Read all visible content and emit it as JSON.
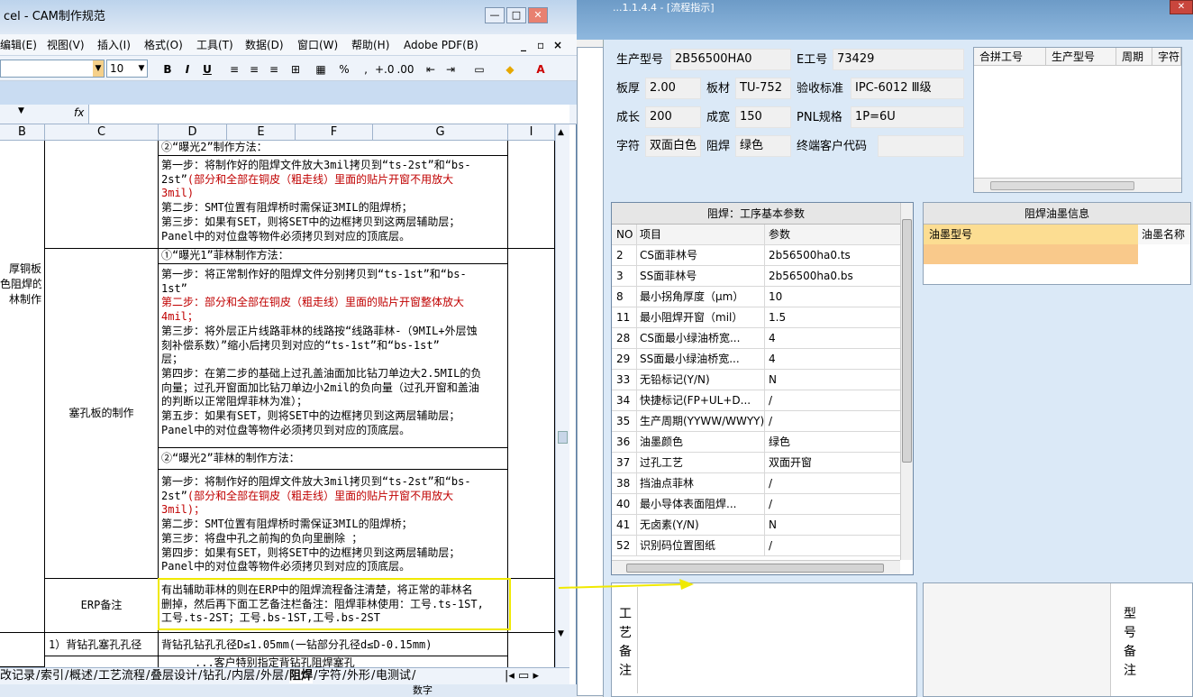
{
  "right_window": {
    "title": "...1.1.4.4 - [流程指示]",
    "close_glyph": "✕",
    "info": {
      "prod_model_label": "生产型号",
      "prod_model": "2B56500HA0",
      "e_no_label": "E工号",
      "e_no": "73429",
      "thickness_label": "板厚",
      "thickness": "2.00",
      "material_label": "板材",
      "material": "TU-752",
      "standard_label": "验收标准",
      "standard": "IPC-6012 Ⅲ级",
      "grow_len_label": "成长",
      "grow_len": "200",
      "grow_wid_label": "成宽",
      "grow_wid": "150",
      "pnl_label": "PNL规格",
      "pnl": "1P=6U",
      "char_label": "字符",
      "char_value": "双面白色",
      "mask_label": "阻焊",
      "mask_value": "绿色",
      "customer_label": "终端客户代码",
      "customer": ""
    },
    "merge_grid": {
      "headers": [
        "合拼工号",
        "生产型号",
        "周期",
        "字符"
      ]
    },
    "solder_params": {
      "title": "阻焊：工序基本参数",
      "headers": [
        "NO",
        "项目",
        "参数"
      ],
      "rows": [
        {
          "no": "2",
          "item": "CS面菲林号",
          "value": "2b56500ha0.ts"
        },
        {
          "no": "3",
          "item": "SS面菲林号",
          "value": "2b56500ha0.bs"
        },
        {
          "no": "8",
          "item": "最小拐角厚度（μm）",
          "value": "10"
        },
        {
          "no": "11",
          "item": "最小阻焊开窗（mil）",
          "value": "1.5"
        },
        {
          "no": "28",
          "item": "CS面最小绿油桥宽...",
          "value": "4"
        },
        {
          "no": "29",
          "item": "SS面最小绿油桥宽...",
          "value": "4"
        },
        {
          "no": "33",
          "item": "无铅标记(Y/N)",
          "value": "N"
        },
        {
          "no": "34",
          "item": "快捷标记(FP+UL+D...",
          "value": "/"
        },
        {
          "no": "35",
          "item": "生产周期(YYWW/WWYY)",
          "value": "/"
        },
        {
          "no": "36",
          "item": "油墨颜色",
          "value": "绿色"
        },
        {
          "no": "37",
          "item": "过孔工艺",
          "value": "双面开窗"
        },
        {
          "no": "38",
          "item": "挡油点菲林",
          "value": "/"
        },
        {
          "no": "40",
          "item": "最小导体表面阻焊...",
          "value": "/"
        },
        {
          "no": "41",
          "item": "无卤素(Y/N)",
          "value": "N"
        },
        {
          "no": "52",
          "item": "识别码位置图纸",
          "value": "/"
        }
      ]
    },
    "ink_info": {
      "title": "阻焊油墨信息",
      "headers": [
        "油墨型号",
        "油墨名称"
      ]
    },
    "notes": {
      "process_label": [
        "工",
        "艺",
        "备",
        "注"
      ],
      "model_label": [
        "型",
        "号",
        "备",
        "注"
      ]
    }
  },
  "excel": {
    "title": "cel - CAM制作规范",
    "window_buttons": [
      "—",
      "□",
      "✕"
    ],
    "menu": [
      "编辑(E)",
      "视图(V)",
      "插入(I)",
      "格式(O)",
      "工具(T)",
      "数据(D)",
      "窗口(W)",
      "帮助(H)",
      "Adobe PDF(B)"
    ],
    "menu_right": [
      "_",
      "▫",
      "×"
    ],
    "font_size": "10",
    "toolbar": [
      "B",
      "I",
      "U",
      "≡",
      "≡",
      "≡",
      "⊞",
      "▦",
      "%",
      ",",
      "+.0",
      ".00",
      "⇤",
      "⇥",
      "▭",
      "◆",
      "A"
    ],
    "fx": "fx",
    "columns": [
      "B",
      "C",
      "D",
      "E",
      "F",
      "G",
      "I"
    ],
    "cells": {
      "b_label": [
        "厚铜板",
        "色阻焊的",
        "林制作"
      ],
      "c_plug": "塞孔板的制作",
      "c_erp": "ERP备注",
      "c_back": "1）背钻孔塞孔孔径",
      "d1": [
        "②“曝光2”制作方法："
      ],
      "d2": [
        {
          "t": "第一步：将制作好的阻焊文件放大3mil拷贝到“ts-2st”和“bs-",
          "r": false
        },
        {
          "t": "2st”",
          "r": false,
          "tail": "(部分和全部在铜皮（粗走线）里面的贴片开窗不用放大"
        },
        {
          "t": "3mil)",
          "r": true
        },
        {
          "t": "第二步：SMT位置有阻焊桥时需保证3MIL的阻焊桥；",
          "r": false
        },
        {
          "t": "第三步：如果有SET，则将SET中的边框拷贝到这两层辅助层；",
          "r": false
        },
        {
          "t": "Panel中的对位盘等物件必须拷贝到对应的顶底层。",
          "r": false
        }
      ],
      "d3": [
        "①“曝光1”菲林制作方法："
      ],
      "d4": [
        {
          "t": "第一步：将正常制作好的阻焊文件分别拷贝到“ts-1st”和“bs-",
          "r": false
        },
        {
          "t": "1st”",
          "r": false
        },
        {
          "t": "第二步：部分和全部在铜皮（粗走线）里面的贴片开窗整体放大",
          "r": true
        },
        {
          "t": "4mil；",
          "r": true
        },
        {
          "t": "第三步：将外层正片线路菲林的线路按“线路菲林-（9MIL+外层蚀",
          "r": false
        },
        {
          "t": "刻补偿系数）”缩小后拷贝到对应的“ts-1st”和“bs-1st”",
          "r": false
        },
        {
          "t": "层；",
          "r": false
        },
        {
          "t": "第四步：在第二步的基础上过孔盖油面加比钻刀单边大2.5MIL的负",
          "r": false
        },
        {
          "t": "向量；过孔开窗面加比钻刀单边小2mil的负向量（过孔开窗和盖油",
          "r": false
        },
        {
          "t": "的判断以正常阻焊菲林为准）；",
          "r": false
        },
        {
          "t": "第五步：如果有SET，则将SET中的边框拷贝到这两层辅助层；",
          "r": false
        },
        {
          "t": "Panel中的对位盘等物件必须拷贝到对应的顶底层。",
          "r": false
        }
      ],
      "d5": [
        "②“曝光2”菲林的制作方法："
      ],
      "d6": [
        {
          "t": "第一步：将制作好的阻焊文件放大3mil拷贝到“ts-2st”和“bs-",
          "r": false
        },
        {
          "t": "2st”",
          "r": false,
          "tail": "(部分和全部在铜皮（粗走线）里面的贴片开窗不用放大"
        },
        {
          "t": "3mil)；",
          "r": true
        },
        {
          "t": "第二步：SMT位置有阻焊桥时需保证3MIL的阻焊桥；",
          "r": false
        },
        {
          "t": "第三步：将盘中孔之前掏的负向里删除 ；",
          "r": false
        },
        {
          "t": "第四步：如果有SET，则将SET中的边框拷贝到这两层辅助层；",
          "r": false
        },
        {
          "t": "Panel中的对位盘等物件必须拷贝到对应的顶底层。",
          "r": false
        }
      ],
      "d_erp": [
        "有出辅助菲林的则在ERP中的阻焊流程备注清楚，将正常的菲林名",
        "删掉，然后再下面工艺备注栏备注：阻焊菲林使用：工号.ts-1ST,",
        "工号.ts-2ST；工号.bs-1ST,工号.bs-2ST"
      ],
      "d_back": "背钻孔钻孔孔径D≤1.05mm(一钻部分孔径d≤D-0.15mm)",
      "d_last": "...客户特别指定背钻孔阻焊塞孔"
    },
    "tabs": [
      "改记录",
      "索引",
      "概述",
      "工艺流程",
      "叠层设计",
      "钻孔",
      "内层",
      "外层",
      "阻焊",
      "字符",
      "外形",
      "电测试"
    ],
    "status": "数字"
  },
  "colors": {
    "highlight": "#f0e900",
    "red_text": "#c00000",
    "ink_header": "#fcdd92"
  }
}
